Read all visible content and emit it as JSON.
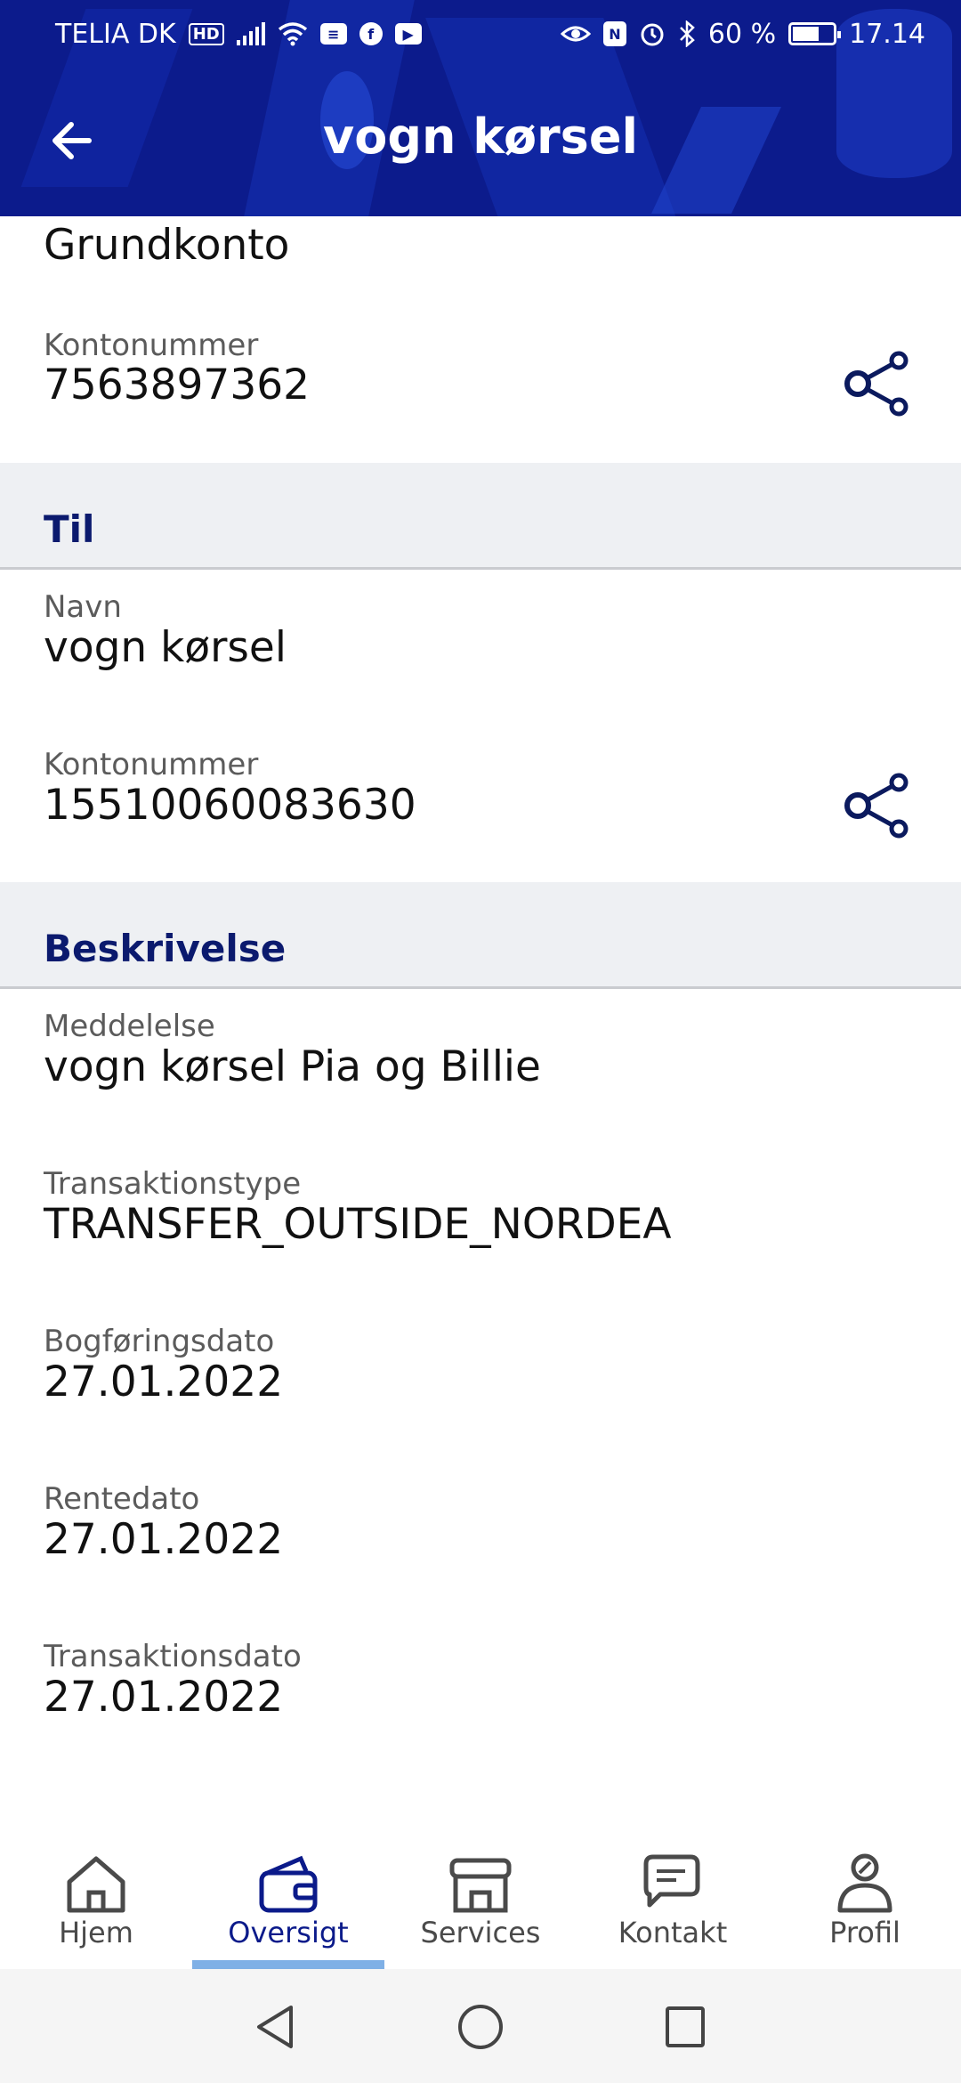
{
  "status_bar": {
    "carrier": "TELIA DK",
    "hd_badge": "HD",
    "battery": "60 %",
    "time": "17.14"
  },
  "header": {
    "title": "vogn kørsel"
  },
  "from": {
    "account_name": "Grundkonto",
    "account_label": "Kontonummer",
    "account_number": "7563897362"
  },
  "to": {
    "section_title": "Til",
    "name_label": "Navn",
    "name_value": "vogn kørsel",
    "account_label": "Kontonummer",
    "account_number": "15510060083630"
  },
  "description": {
    "section_title": "Beskrivelse",
    "fields": [
      {
        "label": "Meddelelse",
        "value": "vogn kørsel Pia og Billie"
      },
      {
        "label": "Transaktionstype",
        "value": "TRANSFER_OUTSIDE_NORDEA"
      },
      {
        "label": "Bogføringsdato",
        "value": "27.01.2022"
      },
      {
        "label": "Rentedato",
        "value": "27.01.2022"
      },
      {
        "label": "Transaktionsdato",
        "value": "27.01.2022"
      }
    ]
  },
  "bottom_nav": {
    "items": [
      {
        "label": "Hjem",
        "icon": "home-icon"
      },
      {
        "label": "Oversigt",
        "icon": "wallet-icon",
        "active": true
      },
      {
        "label": "Services",
        "icon": "shop-icon"
      },
      {
        "label": "Kontakt",
        "icon": "chat-icon"
      },
      {
        "label": "Profil",
        "icon": "profile-icon"
      }
    ]
  },
  "colors": {
    "header_bg": "#0c1b8c",
    "accent_dark": "#0b1a6e",
    "active_indicator": "#7fb0e6",
    "section_bg": "#eef0f3"
  }
}
